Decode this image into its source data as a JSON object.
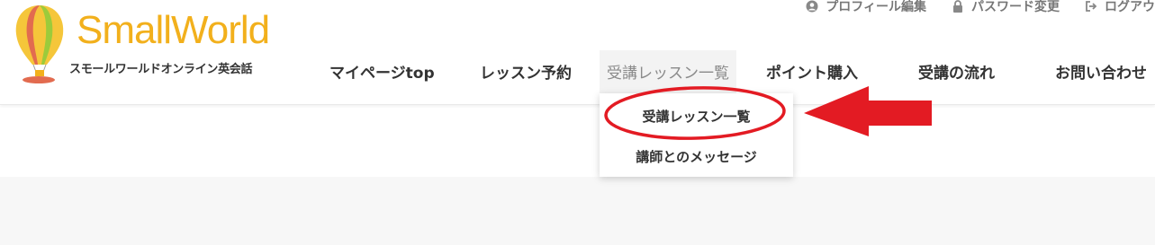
{
  "logo": {
    "title": "SmallWorld",
    "subtitle": "スモールワールドオンライン英会話"
  },
  "topbar": {
    "profile_label": "プロフィール編集",
    "password_label": "パスワード変更",
    "logout_label": "ログアウ"
  },
  "nav": {
    "items": [
      {
        "label": "マイページtop"
      },
      {
        "label": "レッスン予約"
      },
      {
        "label": "受講レッスン一覧"
      },
      {
        "label": "ポイント購入"
      },
      {
        "label": "受講の流れ"
      },
      {
        "label": "お問い合わせ"
      }
    ]
  },
  "dropdown": {
    "items": [
      {
        "label": "受講レッスン一覧"
      },
      {
        "label": "講師とのメッセージ"
      }
    ]
  },
  "annotation": {
    "color": "#e31b23"
  },
  "colors": {
    "brand": "#f2b01c",
    "nav_active_bg": "#f3f3f3"
  }
}
